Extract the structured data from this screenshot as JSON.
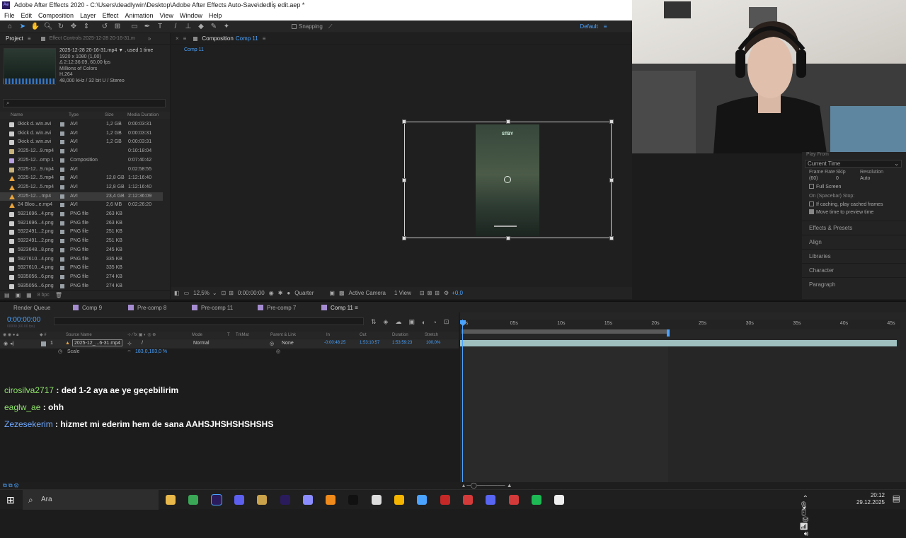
{
  "window": {
    "title": "Adobe After Effects 2020 - C:\\Users\\deadlywin\\Desktop\\Adobe After Effects Auto-Save\\dedli̇ş edit.aep *",
    "menus": [
      "File",
      "Edit",
      "Composition",
      "Layer",
      "Effect",
      "Animation",
      "View",
      "Window",
      "Help"
    ]
  },
  "toolbar": {
    "snapping": "Snapping",
    "workspace": "Default"
  },
  "project": {
    "tab": "Project",
    "effect_controls": "Effect Controls 2025-12-28 20-16-31.m",
    "file": {
      "name": "2025-12-28 20-16-31.mp4 ▼ , used 1 time",
      "res": "1920 x 1080 (1,00)",
      "dur": "Δ 2:12:36:09, 60,00 fps",
      "colors": "Millions of Colors",
      "codec": "H.264",
      "audio": "48,000 kHz / 32 bit U / Stereo"
    },
    "columns": [
      "Name",
      "Type",
      "Size",
      "Media Duration"
    ],
    "rows": [
      {
        "name": "0kick d..win.avi",
        "type": "AVI",
        "size": "1,2 GB",
        "dur": "0:00:03:31",
        "icon": "file"
      },
      {
        "name": "0kick d..win.avi",
        "type": "AVI",
        "size": "1,2 GB",
        "dur": "0:00:03:31",
        "icon": "file"
      },
      {
        "name": "0kick d..win.avi",
        "type": "AVI",
        "size": "1,2 GB",
        "dur": "0:00:03:31",
        "icon": "file"
      },
      {
        "name": "2025-12...9.mp4",
        "type": "AVI",
        "size": "",
        "dur": "0:10:18:04",
        "icon": "film"
      },
      {
        "name": "2025-12...omp 1",
        "type": "Composition",
        "size": "",
        "dur": "0:07:40:42",
        "icon": "comp"
      },
      {
        "name": "2025-12...9.mp4",
        "type": "AVI",
        "size": "",
        "dur": "0:02:58:55",
        "icon": "film"
      },
      {
        "name": "2025-12...5.mp4",
        "type": "AVI",
        "size": "12,8 GB",
        "dur": "1:12:16:40",
        "icon": "tri"
      },
      {
        "name": "2025-12...5.mp4",
        "type": "AVI",
        "size": "12,8 GB",
        "dur": "1:12:16:40",
        "icon": "tri"
      },
      {
        "name": "2025-12....mp4",
        "type": "AVI",
        "size": "23,4 GB",
        "dur": "2:12:36:09",
        "icon": "tri",
        "selected": true
      },
      {
        "name": "24 Bloo...e.mp4",
        "type": "AVI",
        "size": "2,6 MB",
        "dur": "0:02:26:20",
        "icon": "tri"
      },
      {
        "name": "5921696...4.png",
        "type": "PNG file",
        "size": "263 KB",
        "dur": "",
        "icon": "file"
      },
      {
        "name": "5921696...4.png",
        "type": "PNG file",
        "size": "263 KB",
        "dur": "",
        "icon": "file"
      },
      {
        "name": "5922491...2.png",
        "type": "PNG file",
        "size": "251 KB",
        "dur": "",
        "icon": "file"
      },
      {
        "name": "5922491...2.png",
        "type": "PNG file",
        "size": "251 KB",
        "dur": "",
        "icon": "file"
      },
      {
        "name": "5923648...8.png",
        "type": "PNG file",
        "size": "245 KB",
        "dur": "",
        "icon": "file"
      },
      {
        "name": "5927610...4.png",
        "type": "PNG file",
        "size": "335 KB",
        "dur": "",
        "icon": "file"
      },
      {
        "name": "5927610...4.png",
        "type": "PNG file",
        "size": "335 KB",
        "dur": "",
        "icon": "file"
      },
      {
        "name": "5935056...6.png",
        "type": "PNG file",
        "size": "274 KB",
        "dur": "",
        "icon": "file"
      },
      {
        "name": "5935056...6.png",
        "type": "PNG file",
        "size": "274 KB",
        "dur": "",
        "icon": "file"
      }
    ],
    "bpc": "8 bpc"
  },
  "composition": {
    "tab": "Composition",
    "comp_name": "Comp 11",
    "breadcrumb": "Comp 11",
    "stby": "STBY",
    "zoom": "12,5%",
    "time": "0:00:00:00",
    "resolution": "Quarter",
    "camera": "Active Camera",
    "views": "1 View",
    "exposure": "+0,0"
  },
  "preview": {
    "play_from": "Play From",
    "current_time": "Current Time",
    "frame_rate_label": "Frame Rate",
    "skip_label": "Skip",
    "resolution_label": "Resolution",
    "frame_rate": "(60)",
    "skip": "0",
    "resolution": "Auto",
    "full_screen": "Full Screen",
    "on_stop": "On (Spacebar) Stop:",
    "cached": "If caching, play cached frames",
    "move_time": "Move time to preview time",
    "sections": [
      "Effects & Presets",
      "Align",
      "Libraries",
      "Character",
      "Paragraph"
    ]
  },
  "timeline": {
    "tabs": [
      {
        "label": "Render Queue",
        "color": ""
      },
      {
        "label": "Comp 9",
        "color": "#a58cd1"
      },
      {
        "label": "Pre-comp 8",
        "color": "#a58cd1"
      },
      {
        "label": "Pre-comp 11",
        "color": "#a58cd1"
      },
      {
        "label": "Pre-comp 7",
        "color": "#a58cd1"
      },
      {
        "label": "Comp 11",
        "color": "#a58cd1",
        "active": true
      }
    ],
    "time": "0:00:00:00",
    "frames": "00000 (60.00 fps)",
    "columns": {
      "source": "Source Name",
      "mode": "Mode",
      "t": "T",
      "trkmat": "TrkMat",
      "parent": "Parent & Link",
      "in": "In",
      "out": "Out",
      "duration": "Duration",
      "stretch": "Stretch"
    },
    "layer": {
      "num": "1",
      "name": "2025-12_...6-31.mp4",
      "mode": "Normal",
      "parent": "None",
      "in": "-0:00:48:25",
      "out": "1:53:10:57",
      "duration": "1:53:59:23",
      "stretch": "100,0%"
    },
    "scale": {
      "label": "Scale",
      "value": "183,0,183,0 %"
    },
    "ruler": [
      "0s",
      "05s",
      "10s",
      "15s",
      "20s",
      "25s",
      "30s",
      "35s",
      "40s",
      "45s"
    ]
  },
  "chat": [
    {
      "user": "cirosilva2717",
      "user_color": "#8fe36b",
      "msg": " : ded 1-2 aya ae ye geçebilirim"
    },
    {
      "user": "eaglw_ae",
      "user_color": "#8fe36b",
      "msg": " : ohh"
    },
    {
      "user": "Zezesekerim",
      "user_color": "#6fa8ff",
      "msg": " : hizmet mi ederim hem de sana AAHSJHSHSHSHSHS"
    }
  ],
  "taskbar": {
    "search": "Ara",
    "time": "20:12",
    "date": "29.12.2025"
  }
}
